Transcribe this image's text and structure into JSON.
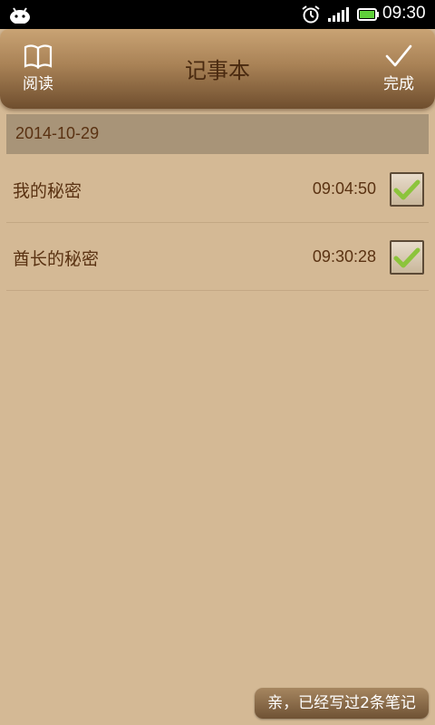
{
  "status_bar": {
    "time": "09:30",
    "icons": [
      "android-icon",
      "alarm-icon",
      "signal-icon",
      "battery-icon"
    ]
  },
  "header": {
    "title": "记事本",
    "left_button": {
      "label": "阅读",
      "icon": "book-icon"
    },
    "right_button": {
      "label": "完成",
      "icon": "checkmark-icon"
    }
  },
  "date_group": {
    "date": "2014-10-29"
  },
  "notes": [
    {
      "name": "我的秘密",
      "time": "09:04:50",
      "checked": true
    },
    {
      "name": "酋长的秘密",
      "time": "09:30:28",
      "checked": true
    }
  ],
  "footer": {
    "summary": "亲，已经写过2条笔记"
  },
  "colors": {
    "background": "#d4b995",
    "text": "#5a3212",
    "check_green": "#8cc43c"
  }
}
